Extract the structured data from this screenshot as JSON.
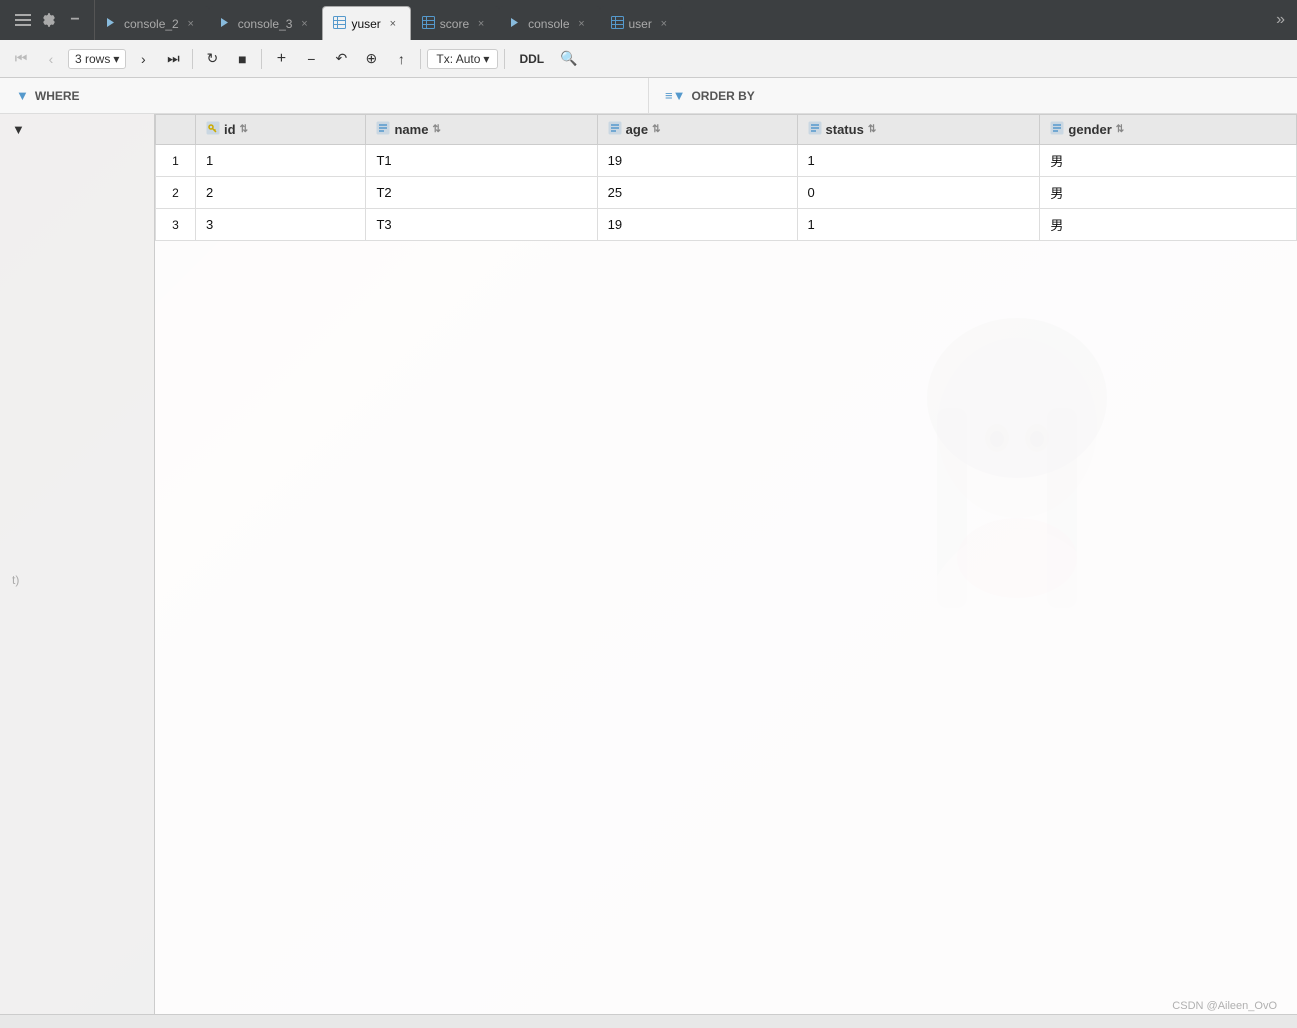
{
  "tabs": [
    {
      "id": "console_2",
      "label": "console_2",
      "type": "console",
      "active": false
    },
    {
      "id": "console_3",
      "label": "console_3",
      "type": "console",
      "active": false
    },
    {
      "id": "yuser",
      "label": "yuser",
      "type": "table",
      "active": true
    },
    {
      "id": "score",
      "label": "score",
      "type": "table",
      "active": false
    },
    {
      "id": "console",
      "label": "console",
      "type": "console",
      "active": false
    },
    {
      "id": "user",
      "label": "user",
      "type": "table",
      "active": false
    }
  ],
  "toolbar": {
    "row_count_label": "3 rows",
    "tx_label": "Tx: Auto",
    "ddl_label": "DDL"
  },
  "filter_bar": {
    "where_label": "WHERE",
    "order_by_label": "ORDER BY"
  },
  "table": {
    "columns": [
      {
        "name": "id",
        "type": "pk",
        "icon": "pk"
      },
      {
        "name": "name",
        "type": "text",
        "icon": "col"
      },
      {
        "name": "age",
        "type": "number",
        "icon": "col"
      },
      {
        "name": "status",
        "type": "number",
        "icon": "col"
      },
      {
        "name": "gender",
        "type": "text",
        "icon": "col"
      }
    ],
    "rows": [
      {
        "row_num": "1",
        "id": "1",
        "name": "T1",
        "age": "19",
        "status": "1",
        "gender": "男"
      },
      {
        "row_num": "2",
        "id": "2",
        "name": "T2",
        "age": "25",
        "status": "0",
        "gender": "男"
      },
      {
        "row_num": "3",
        "id": "3",
        "name": "T3",
        "age": "19",
        "status": "1",
        "gender": "男"
      }
    ]
  },
  "watermark": "CSDN @Aileen_OvO",
  "icons": {
    "menu": "☰",
    "gear": "⚙",
    "minus": "−",
    "filter": "▼",
    "first": "⏮",
    "prev": "‹",
    "next": "›",
    "last": "⏭",
    "refresh": "↻",
    "stop": "■",
    "add": "+",
    "remove": "−",
    "undo": "↶",
    "copy": "⊕",
    "export": "↑",
    "chevron": "▾",
    "search": "🔍",
    "sort": "⇅",
    "more": "»"
  }
}
